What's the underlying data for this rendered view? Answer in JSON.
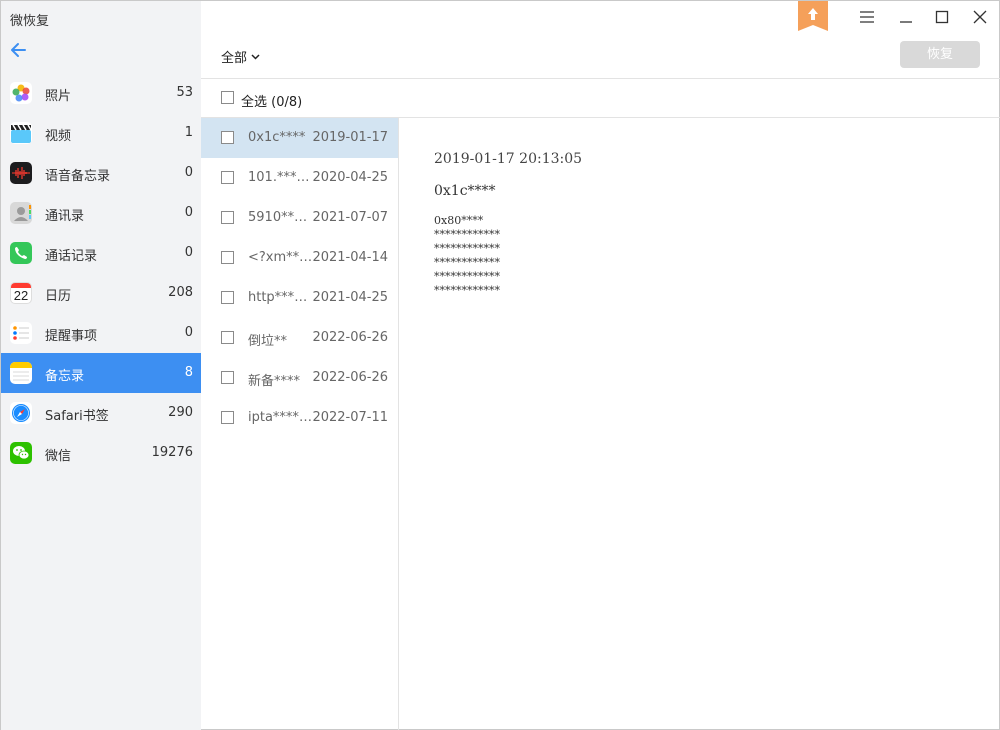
{
  "app": {
    "title": "微恢复"
  },
  "sidebar": {
    "items": [
      {
        "label": "照片",
        "count": "53",
        "icon": "photos-icon"
      },
      {
        "label": "视频",
        "count": "1",
        "icon": "video-icon"
      },
      {
        "label": "语音备忘录",
        "count": "0",
        "icon": "voice-memo-icon"
      },
      {
        "label": "通讯录",
        "count": "0",
        "icon": "contacts-icon"
      },
      {
        "label": "通话记录",
        "count": "0",
        "icon": "phone-icon"
      },
      {
        "label": "日历",
        "count": "208",
        "icon": "calendar-icon",
        "calendar_day": "22"
      },
      {
        "label": "提醒事项",
        "count": "0",
        "icon": "reminders-icon"
      },
      {
        "label": "备忘录",
        "count": "8",
        "icon": "notes-icon",
        "active": true
      },
      {
        "label": "Safari书签",
        "count": "290",
        "icon": "safari-icon"
      },
      {
        "label": "微信",
        "count": "19276",
        "icon": "wechat-icon"
      }
    ]
  },
  "toolbar": {
    "filter_label": "全部",
    "restore_label": "恢复"
  },
  "selection": {
    "label": "全选 (0/8)"
  },
  "list": {
    "rows": [
      {
        "name": "0x1c****",
        "date": "2019-01-17",
        "selected": true
      },
      {
        "name": "101.*****...",
        "date": "2020-04-25"
      },
      {
        "name": "5910****...",
        "date": "2021-07-07"
      },
      {
        "name": "<?xm***...",
        "date": "2021-04-14"
      },
      {
        "name": "http*****...",
        "date": "2021-04-25"
      },
      {
        "name": "倒垃**",
        "date": "2022-06-26"
      },
      {
        "name": "新备****",
        "date": "2022-06-26"
      },
      {
        "name": "ipta*****...",
        "date": "2022-07-11"
      }
    ]
  },
  "preview": {
    "date": "2019-01-17 20:13:05",
    "title": "0x1c****",
    "lines": [
      "0x80****",
      "************",
      "************",
      "************",
      "************",
      "************"
    ]
  },
  "colors": {
    "accent": "#3d8ff2",
    "selected_row": "#d3e4f2",
    "sidebar_bg": "#f2f3f5",
    "badge": "#f5a05a"
  }
}
